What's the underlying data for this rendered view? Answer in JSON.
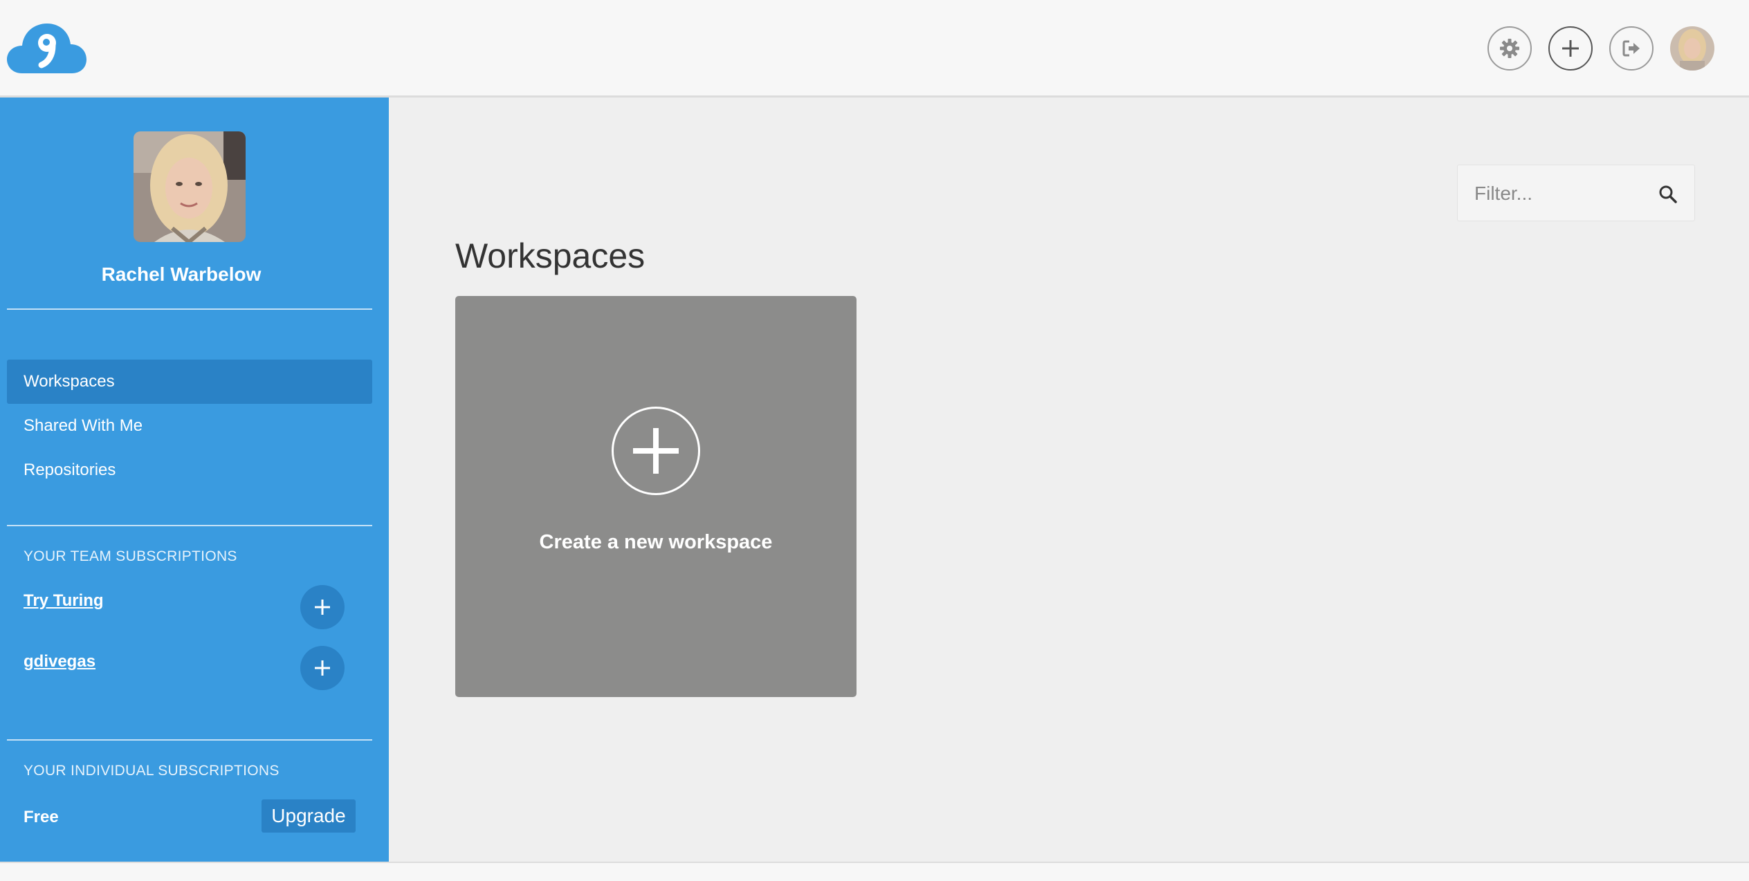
{
  "topbar": {
    "logo_icon": "cloud9-logo",
    "buttons": [
      {
        "icon": "gear-icon"
      },
      {
        "icon": "plus-icon"
      },
      {
        "icon": "sign-out-icon"
      }
    ],
    "avatar_icon": "user-avatar"
  },
  "sidebar": {
    "user_name": "Rachel Warbelow",
    "nav": [
      {
        "label": "Workspaces",
        "active": true
      },
      {
        "label": "Shared With Me",
        "active": false
      },
      {
        "label": "Repositories",
        "active": false
      }
    ],
    "team_section_label": "YOUR TEAM SUBSCRIPTIONS",
    "teams": [
      {
        "label": "Try Turing"
      },
      {
        "label": "gdivegas"
      }
    ],
    "individual_section_label": "YOUR INDIVIDUAL SUBSCRIPTIONS",
    "plan": "Free",
    "upgrade_label": "Upgrade"
  },
  "main": {
    "filter_placeholder": "Filter...",
    "title": "Workspaces",
    "create_card_label": "Create a new workspace"
  },
  "colors": {
    "sidebar_bg": "#3a9be0",
    "sidebar_active": "#2a82c6",
    "card_bg": "#8c8c8b",
    "main_bg": "#efefef"
  }
}
